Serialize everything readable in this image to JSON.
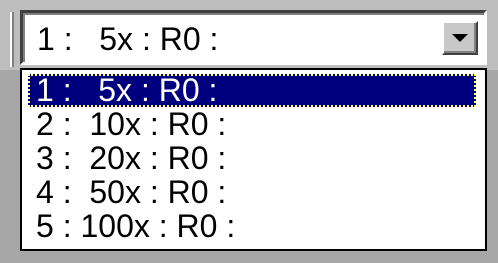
{
  "combo": {
    "value": "1 :   5x : R0 :",
    "options": [
      "1 :   5x : R0 :",
      "2 :  10x : R0 :",
      "3 :  20x : R0 :",
      "4 :  50x : R0 :",
      "5 : 100x : R0 :"
    ],
    "selected_index": 0
  },
  "colors": {
    "selection_background": "#00007e",
    "selection_text": "#ffffff",
    "focus_outline": "#ffff66"
  },
  "icons": {
    "dropdown": "chevron-down-icon"
  }
}
